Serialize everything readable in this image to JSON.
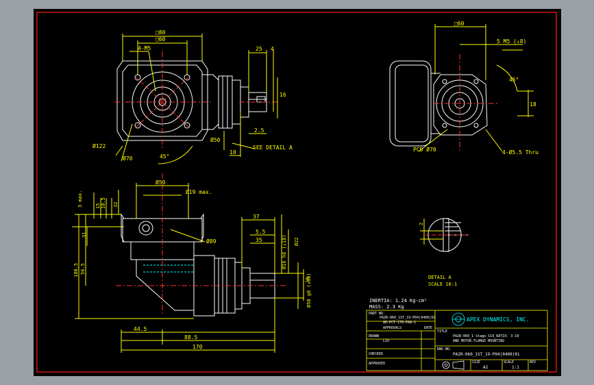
{
  "colors": {
    "sheet": "#000000",
    "border": "#ff2020",
    "outline": "#ffffff",
    "dimension": "#ffff00",
    "center": "#ff3030",
    "hidden": "#00ffff",
    "logo": "#00ffff"
  },
  "top_left_view": {
    "dim_80": "□80",
    "dim_60": "□60",
    "holes": "4-M5",
    "dia_122": "Ø122",
    "dia_70": "Ø70",
    "angle": "45°"
  },
  "top_middle_view": {
    "dim_25": "25",
    "dim_4": "4",
    "dim_16": "16",
    "dim_2_5": "2.5",
    "dia_50": "Ø50",
    "dim_10": "10",
    "detail_ref": "SEE DETAIL A"
  },
  "top_right_view": {
    "dim_60": "□60",
    "thread": "5 M5 (↓8)",
    "angle": "45°",
    "dim_18": "18",
    "pcd": "PCD Ø70",
    "holes": "4-Ø5.5 Thru"
  },
  "bottom_view": {
    "dia_50_top": "Ø50",
    "dia_19": "Ø19 max.",
    "dim_3max": "3 max.",
    "dim_15": "15",
    "dim_10_5": "10.5",
    "dim_32": "32",
    "dim_31": "31",
    "dim_565": "56.5",
    "dim_1805": "180.5",
    "dia_89": "Ø89",
    "dim_37": "37",
    "dim_5_5": "5.5",
    "dim_35": "35",
    "dia_16": "Ø16 h6 (↓18)",
    "dia_22": "Ø22",
    "dia_50_side": "Ø50 g6 (↓10)",
    "dim_445": "44.5",
    "dim_885": "88.5",
    "dim_170": "170",
    "dim_18": "18"
  },
  "detail_a": {
    "dim_2": "2",
    "label": "DETAIL A",
    "scale": "SCALE 10:1"
  },
  "notes": {
    "inertia": "INERTIA: 1.24 Kg-cm²",
    "mass": "MASS: 2.3  Kg"
  },
  "title_block": {
    "part_no_label": "PART NO.",
    "part_no_line1": "PA2R-060_1ST_19-P04|0400|01",
    "part_no_line2": "AD-PCT-178-PAA-1",
    "approval_label": "APPROVALS",
    "date_label": "DATE",
    "drawn_label": "DRAWN",
    "drawn_value": "LIU",
    "checked_label": "CHECKED",
    "approved_label": "APPROVED",
    "company": "APEX DYNAMICS, INC.",
    "title_label": "TITLE",
    "title_line1": "PA2R-060_1 Stage_S19_RATIO: 3-10",
    "title_line2": "AND MOTOR FLANGE MOUNTING",
    "dwg_no_label": "DWG NO.",
    "dwg_no": "PA2R-060_1ST_19-P04|0400|01",
    "size_label": "SIZE",
    "size_value": "A2",
    "scale_label": "SCALE",
    "scale_value": "1:1",
    "rev_label": "REV"
  }
}
